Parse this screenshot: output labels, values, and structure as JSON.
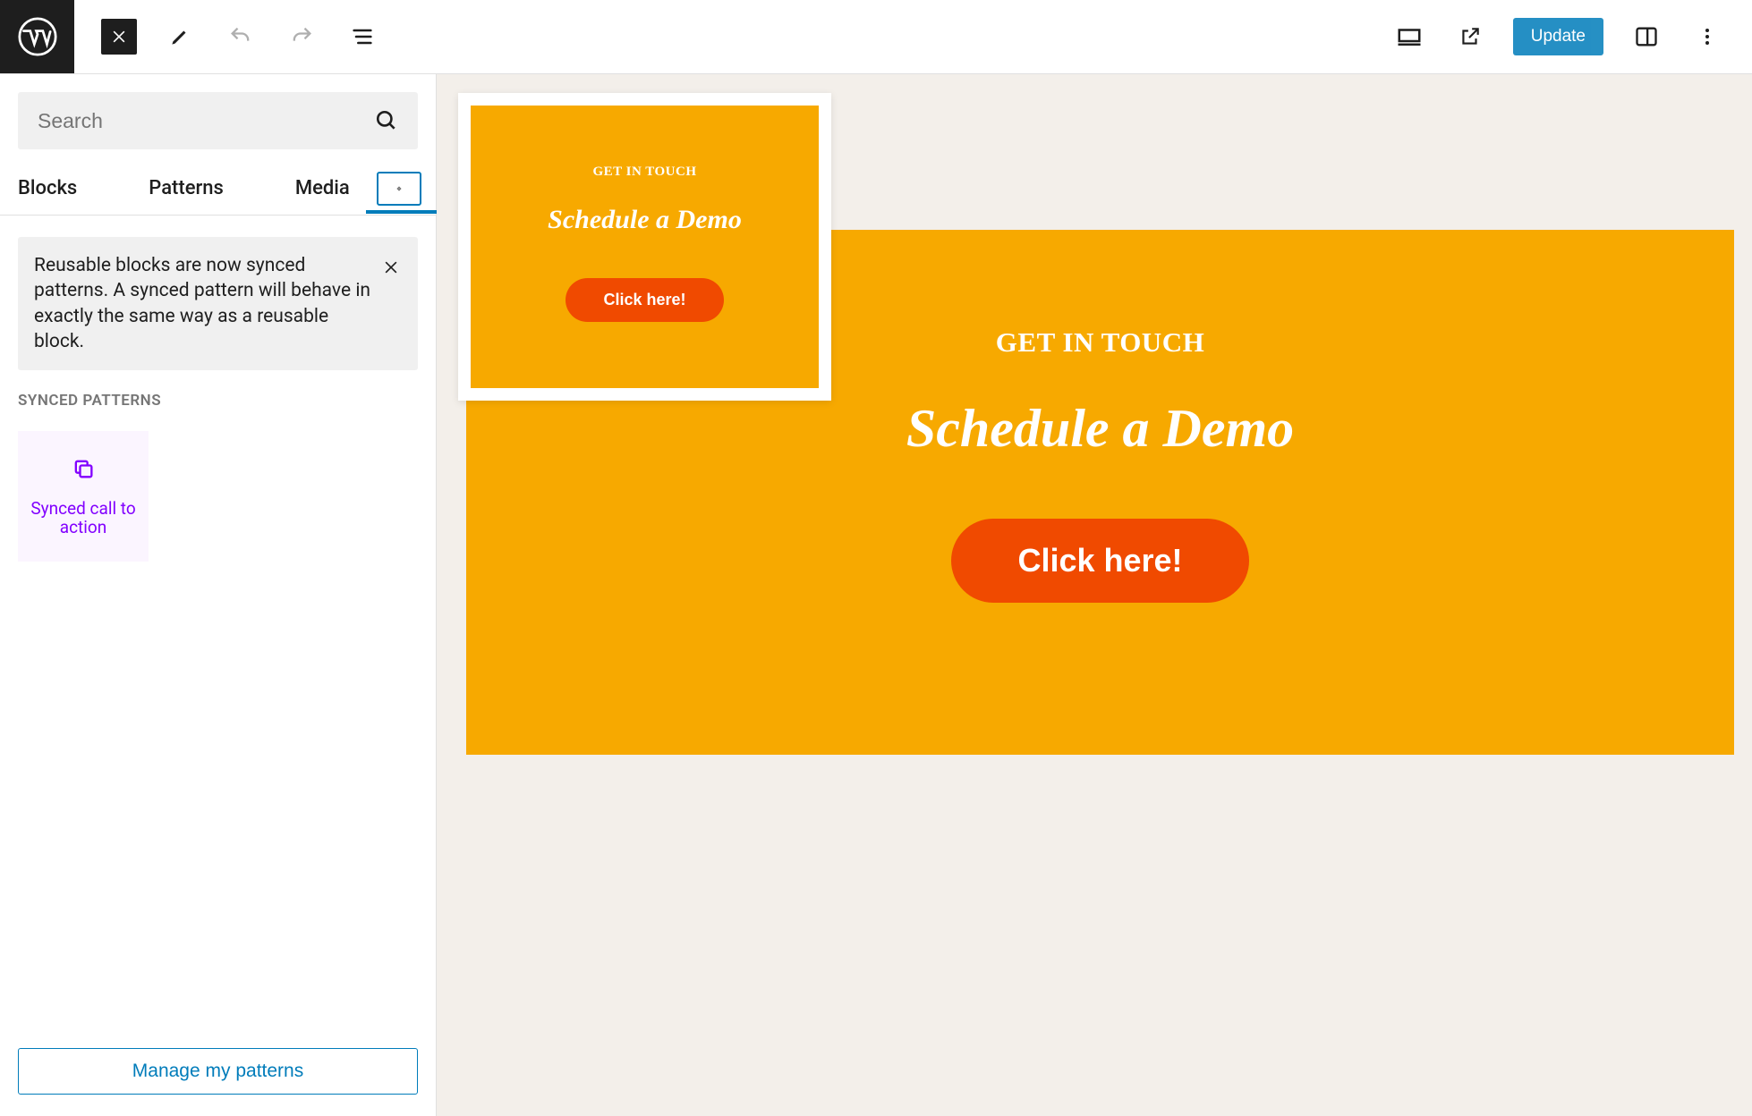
{
  "topbar": {
    "update_label": "Update"
  },
  "sidebar": {
    "search_placeholder": "Search",
    "tabs": {
      "blocks": "Blocks",
      "patterns": "Patterns",
      "media": "Media"
    },
    "notice": "Reusable blocks are now synced patterns. A synced pattern will behave in exactly the same way as a reusable block.",
    "section_label": "SYNCED PATTERNS",
    "pattern_item_label": "Synced call to action",
    "manage_label": "Manage my patterns"
  },
  "canvas": {
    "kicker": "GET IN TOUCH",
    "title": "Schedule a Demo",
    "button": "Click here!"
  },
  "preview": {
    "kicker": "GET IN TOUCH",
    "title": "Schedule a Demo",
    "button": "Click here!"
  }
}
